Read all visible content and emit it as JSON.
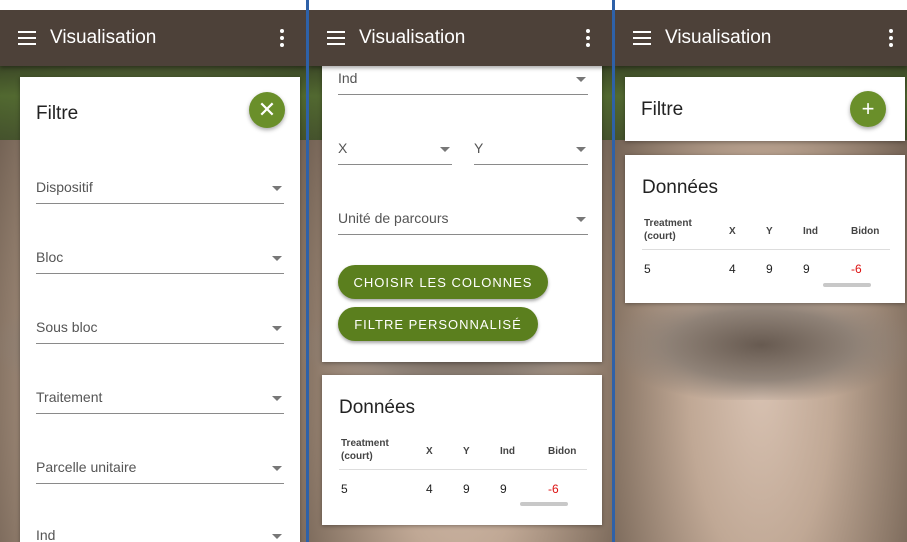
{
  "appbar": {
    "title": "Visualisation"
  },
  "filter": {
    "title": "Filtre",
    "fields": [
      "Dispositif",
      "Bloc",
      "Sous bloc",
      "Traitement",
      "Parcelle unitaire",
      "Ind"
    ],
    "field_ind": "Ind",
    "field_x": "X",
    "field_y": "Y",
    "field_unite": "Unité de parcours",
    "btn_columns": "CHOISIR LES COLONNES",
    "btn_custom": "FILTRE PERSONNALISÉ"
  },
  "data": {
    "title": "Données",
    "headers": [
      "Treatment (court)",
      "X",
      "Y",
      "Ind",
      "Bidon"
    ],
    "row": [
      "5",
      "4",
      "9",
      "9",
      "-6"
    ]
  },
  "colors": {
    "appbar": "#4d4139",
    "accent": "#6a8f2a",
    "negative": "#d11111"
  }
}
